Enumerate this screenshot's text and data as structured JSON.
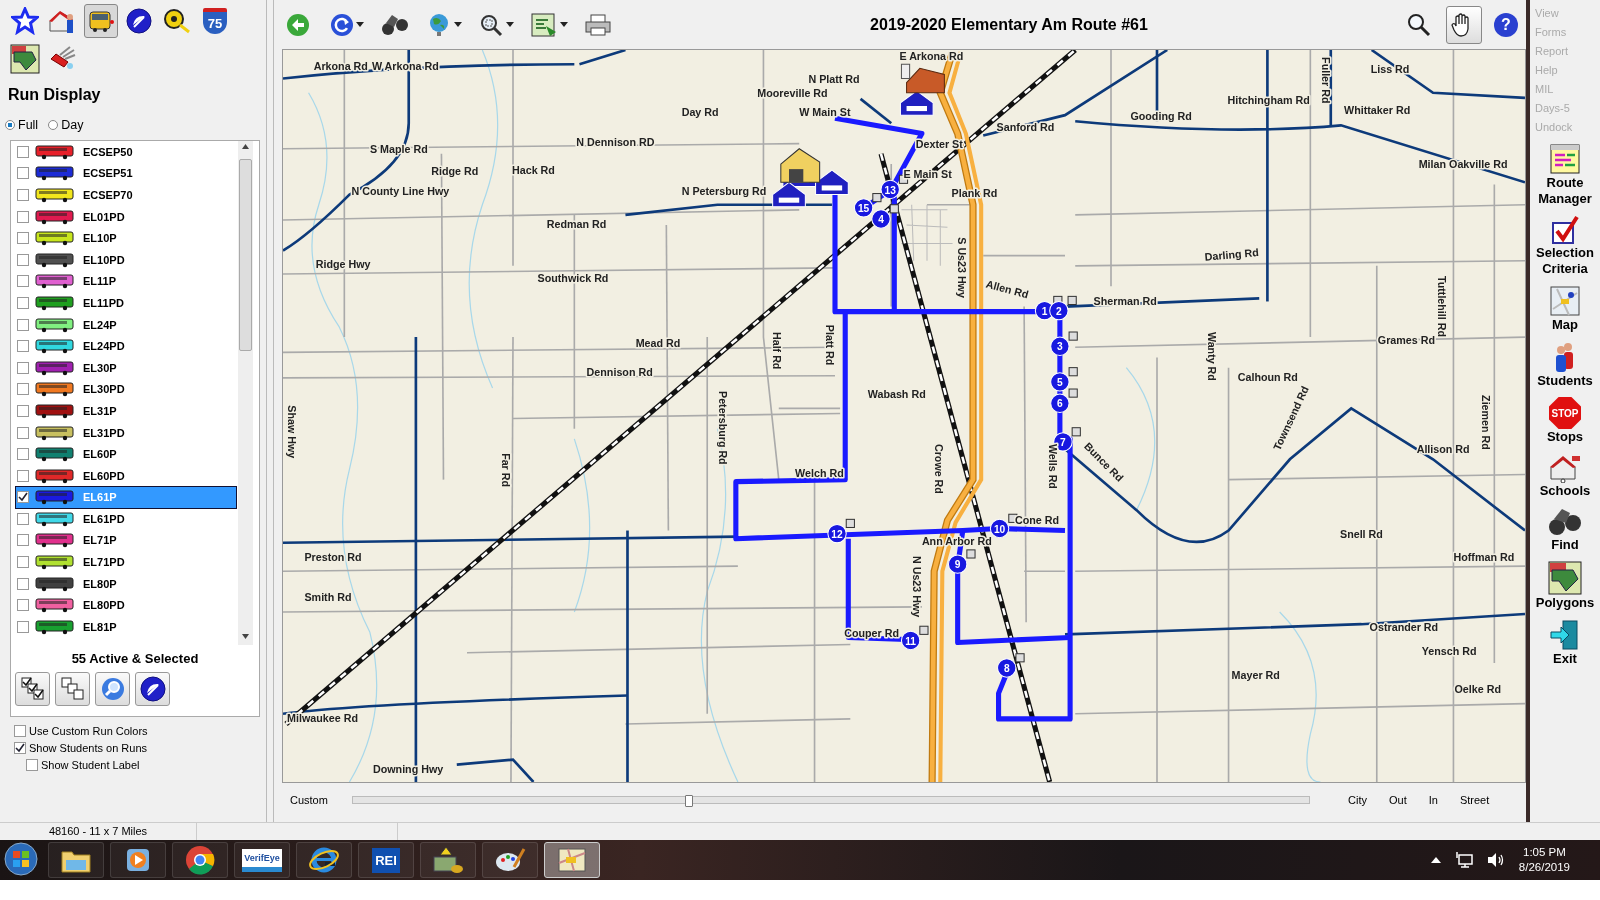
{
  "left_toolbar": {
    "tools": [
      {
        "kind": "star",
        "selected": false
      },
      {
        "kind": "school",
        "selected": false
      },
      {
        "kind": "bus",
        "selected": true
      },
      {
        "kind": "dish",
        "selected": false
      },
      {
        "kind": "tape",
        "selected": false
      },
      {
        "kind": "shield",
        "selected": false,
        "label": "75"
      },
      {
        "kind": "polygon",
        "selected": false
      },
      {
        "kind": "knife",
        "selected": false
      }
    ]
  },
  "run_display": {
    "title": "Run Display",
    "modes": [
      {
        "label": "Full",
        "selected": true
      },
      {
        "label": "Day",
        "selected": false
      }
    ],
    "runs": [
      {
        "name": "ECSEP50",
        "color": "#e8202a",
        "checked": false,
        "selected": false
      },
      {
        "name": "ECSEP51",
        "color": "#1c2bd6",
        "checked": false,
        "selected": false
      },
      {
        "name": "ECSEP70",
        "color": "#f2e61c",
        "checked": false,
        "selected": false
      },
      {
        "name": "EL01PD",
        "color": "#e01a4f",
        "checked": false,
        "selected": false
      },
      {
        "name": "EL10P",
        "color": "#c8e61c",
        "checked": false,
        "selected": false
      },
      {
        "name": "EL10PD",
        "color": "#505050",
        "checked": false,
        "selected": false
      },
      {
        "name": "EL11P",
        "color": "#e060d0",
        "checked": false,
        "selected": false
      },
      {
        "name": "EL11PD",
        "color": "#20a020",
        "checked": false,
        "selected": false
      },
      {
        "name": "EL24P",
        "color": "#80f080",
        "checked": false,
        "selected": false
      },
      {
        "name": "EL24PD",
        "color": "#30d8e0",
        "checked": false,
        "selected": false
      },
      {
        "name": "EL30P",
        "color": "#a020b0",
        "checked": false,
        "selected": false
      },
      {
        "name": "EL30PD",
        "color": "#f07820",
        "checked": false,
        "selected": false
      },
      {
        "name": "EL31P",
        "color": "#a01010",
        "checked": false,
        "selected": false
      },
      {
        "name": "EL31PD",
        "color": "#c8c060",
        "checked": false,
        "selected": false
      },
      {
        "name": "EL60P",
        "color": "#108070",
        "checked": false,
        "selected": false
      },
      {
        "name": "EL60PD",
        "color": "#e02828",
        "checked": false,
        "selected": false
      },
      {
        "name": "EL61P",
        "color": "#1a1ae0",
        "checked": true,
        "selected": true
      },
      {
        "name": "EL61PD",
        "color": "#40d8e8",
        "checked": false,
        "selected": false
      },
      {
        "name": "EL71P",
        "color": "#e0308c",
        "checked": false,
        "selected": false
      },
      {
        "name": "EL71PD",
        "color": "#b0e030",
        "checked": false,
        "selected": false
      },
      {
        "name": "EL80P",
        "color": "#404040",
        "checked": false,
        "selected": false
      },
      {
        "name": "EL80PD",
        "color": "#f060a0",
        "checked": false,
        "selected": false
      },
      {
        "name": "EL81P",
        "color": "#18a030",
        "checked": false,
        "selected": false
      }
    ],
    "summary": "55 Active & Selected",
    "actions": [
      {
        "kind": "check-all"
      },
      {
        "kind": "uncheck-all"
      },
      {
        "kind": "zoom"
      },
      {
        "kind": "dish"
      }
    ],
    "options": [
      {
        "label": "Use Custom Run Colors",
        "checked": false
      },
      {
        "label": "Show Students on Runs",
        "checked": true,
        "children": [
          {
            "label": "Show Student Label",
            "checked": false
          }
        ]
      }
    ]
  },
  "map_toolbar": {
    "title": "2019-2020 Elementary Am Route #61",
    "tools": [
      {
        "kind": "back",
        "dropdown": false,
        "selected": false
      },
      {
        "kind": "refresh",
        "dropdown": true,
        "selected": false
      },
      {
        "kind": "binoculars",
        "dropdown": false,
        "selected": false
      },
      {
        "kind": "globe",
        "dropdown": true,
        "selected": false
      },
      {
        "kind": "zoom",
        "dropdown": true,
        "selected": false
      },
      {
        "kind": "export",
        "dropdown": true,
        "selected": false
      },
      {
        "kind": "printer",
        "dropdown": false,
        "selected": false
      }
    ],
    "right_tools": [
      {
        "kind": "search",
        "selected": false
      },
      {
        "kind": "hand",
        "selected": true
      },
      {
        "kind": "help",
        "selected": false,
        "label": "?"
      }
    ]
  },
  "map": {
    "road_labels": [
      "Arkona Rd",
      "W Arkona Rd",
      "E Arkona Rd",
      "N Platt Rd",
      "Mooreville Rd",
      "Day Rd",
      "W Main St",
      "N Dennison RD",
      "S Maple Rd",
      "Ridge Rd",
      "Hack Rd",
      "N County Line Hwy",
      "N Petersburg Rd",
      "Redman Rd",
      "Ridge Hwy",
      "Southwick Rd",
      "Mead Rd",
      "Dennison Rd",
      "Half Rd",
      "Platt Rd",
      "Petersburg Rd",
      "Wabash Rd",
      "Welch Rd",
      "Far Rd",
      "Shaw Hwy",
      "Preston Rd",
      "Smith Rd",
      "Milwaukee Rd",
      "Downing Hwy",
      "Couper Rd",
      "N Us23 Hwy",
      "Ann Arbor Rd",
      "Crowe Rd",
      "Cone Rd",
      "Wells Rd",
      "Bunce Rd",
      "S Us23 Hwy",
      "Allen Rd",
      "Sherman Rd",
      "Dexter St",
      "E Main St",
      "Plank Rd",
      "Sanford Rd",
      "Gooding Rd",
      "Hitchingham Rd",
      "Fuller Rd",
      "Liss Rd",
      "Whittaker Rd",
      "Milan Oakville Rd",
      "Darling Rd",
      "Tuttlehill Rd",
      "Grames Rd",
      "Wanty Rd",
      "Calhoun Rd",
      "Townsend Rd",
      "Ziemen Rd",
      "Allison Rd",
      "Snell Rd",
      "Hoffman Rd",
      "Ostrander Rd",
      "Yensch Rd",
      "Mayer Rd",
      "Oelke Rd"
    ],
    "stops": [
      "1",
      "2",
      "3",
      "4",
      "5",
      "6",
      "7",
      "8",
      "9",
      "10",
      "11",
      "12",
      "13",
      "15"
    ]
  },
  "zoom_bar": {
    "left_label": "Custom",
    "level": 0.35,
    "right_labels": [
      "City",
      "Out",
      "In",
      "Street"
    ]
  },
  "side_menu": {
    "text_items": [
      {
        "label": "View",
        "disabled": true
      },
      {
        "label": "Forms",
        "disabled": true
      },
      {
        "label": "Report",
        "disabled": true
      },
      {
        "label": "Help",
        "disabled": true
      },
      {
        "label": "MIL",
        "disabled": true
      },
      {
        "label": "Days-5",
        "disabled": true
      },
      {
        "label": "Undock",
        "disabled": true
      }
    ],
    "buttons": [
      {
        "kind": "route-manager",
        "label": "Route Manager"
      },
      {
        "kind": "selection",
        "label": "Selection Criteria"
      },
      {
        "kind": "map",
        "label": "Map"
      },
      {
        "kind": "students",
        "label": "Students"
      },
      {
        "kind": "stops",
        "label": "Stops",
        "sign": "STOP"
      },
      {
        "kind": "schools",
        "label": "Schools"
      },
      {
        "kind": "find",
        "label": "Find"
      },
      {
        "kind": "polygons",
        "label": "Polygons"
      },
      {
        "kind": "exit",
        "label": "Exit"
      }
    ]
  },
  "status_bar": {
    "scale": "48160 - 11 x 7 Miles"
  },
  "taskbar": {
    "apps": [
      {
        "kind": "folder",
        "selected": false
      },
      {
        "kind": "media",
        "selected": false
      },
      {
        "kind": "chrome",
        "selected": false
      },
      {
        "kind": "verifeye",
        "label": "VerifEye",
        "selected": false
      },
      {
        "kind": "ie",
        "selected": false
      },
      {
        "kind": "rei",
        "label": "REI",
        "selected": false
      },
      {
        "kind": "money",
        "selected": false
      },
      {
        "kind": "paint",
        "selected": false
      },
      {
        "kind": "mapapp",
        "selected": true
      }
    ],
    "time": "1:05 PM",
    "date": "8/26/2019"
  }
}
